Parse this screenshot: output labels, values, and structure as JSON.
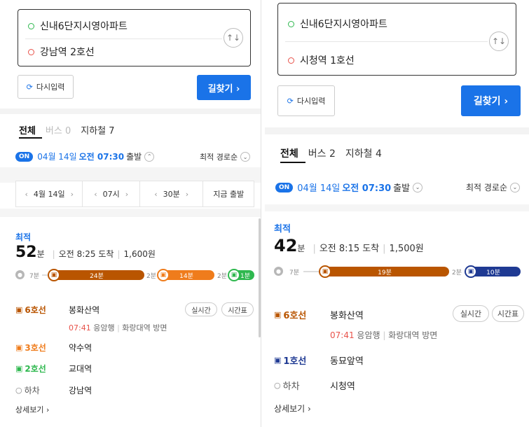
{
  "left": {
    "route": {
      "start": "신내6단지시영아파트",
      "end": "강남역 2호선"
    },
    "reset_label": "다시입력",
    "find_label": "길찾기 ›",
    "tabs": [
      "전체",
      "버스 0",
      "지하철 7"
    ],
    "departure": {
      "on": "ON",
      "date": "04월 14일",
      "time": "오전 07:30",
      "suffix": "출발"
    },
    "sort": "최적 경로순",
    "time_picker": {
      "date": "4월 14일",
      "hour": "07시",
      "minute": "30분",
      "now": "지금 출발"
    },
    "best_label": "최적",
    "summary": {
      "minutes": "52",
      "unit": "분",
      "arrive": "오전 8:25 도착",
      "fare": "1,600원"
    },
    "bar": {
      "walk1": "7분",
      "seg1": "24분",
      "gap1": "2분",
      "seg2": "14분",
      "gap2": "2분",
      "seg3": "1분"
    },
    "steps": [
      {
        "line": "6호선",
        "station": "봉화산역",
        "color": "#b95500"
      },
      {
        "line": "3호선",
        "station": "약수역",
        "color": "#ef7c1c"
      },
      {
        "line": "2호선",
        "station": "교대역",
        "color": "#2fb84f"
      },
      {
        "line": "하차",
        "station": "강남역",
        "color": "#555555"
      }
    ],
    "step1_sub": {
      "time": "07:41",
      "dir1": "응암행",
      "dir2": "화랑대역 방면"
    },
    "realtime": "실시간",
    "timetable": "시간표",
    "more": "상세보기 ›"
  },
  "right": {
    "route": {
      "start": "신내6단지시영아파트",
      "end": "시청역 1호선"
    },
    "reset_label": "다시입력",
    "find_label": "길찾기 ›",
    "tabs": [
      "전체",
      "버스 2",
      "지하철 4"
    ],
    "departure": {
      "on": "ON",
      "date": "04월 14일",
      "time": "오전 07:30",
      "suffix": "출발"
    },
    "sort": "최적 경로순",
    "best_label": "최적",
    "summary": {
      "minutes": "42",
      "unit": "분",
      "arrive": "오전 8:15 도착",
      "fare": "1,500원"
    },
    "bar": {
      "walk1": "7분",
      "seg1": "19분",
      "gap1": "2분",
      "seg2": "10분"
    },
    "steps": [
      {
        "line": "6호선",
        "station": "봉화산역",
        "color": "#b95500"
      },
      {
        "line": "1호선",
        "station": "동묘앞역",
        "color": "#1f3a93"
      },
      {
        "line": "하차",
        "station": "시청역",
        "color": "#555555"
      }
    ],
    "step1_sub": {
      "time": "07:41",
      "dir1": "응암행",
      "dir2": "화랑대역 방면"
    },
    "realtime": "실시간",
    "timetable": "시간표",
    "more": "상세보기 ›"
  },
  "colors": {
    "accent": "#1a73e8",
    "line6": "#b95500",
    "line3": "#ef7c1c",
    "line2": "#2fb84f",
    "line1": "#1f3a93"
  },
  "icons": {
    "swap": "swap-vertical-icon",
    "reset": "refresh-icon",
    "train": "train-icon",
    "walk": "walk-icon"
  }
}
